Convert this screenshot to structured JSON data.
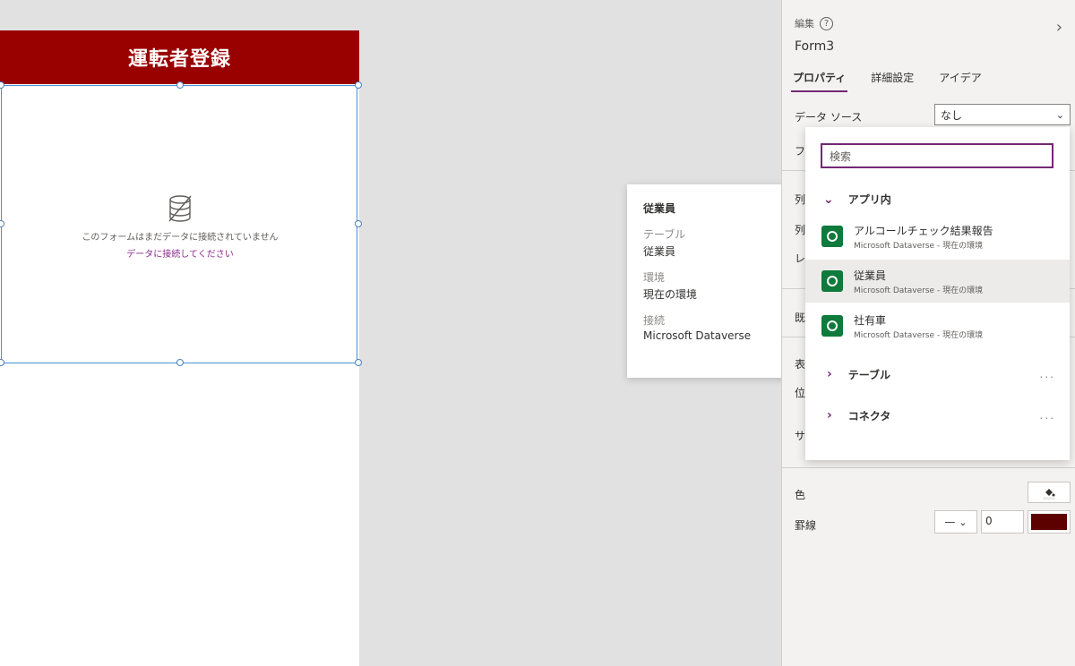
{
  "screen": {
    "title": "運転者登録",
    "form_message": "このフォームはまだデータに接続されていません",
    "form_link": "データに接続してください"
  },
  "info_card": {
    "title": "従業員",
    "table_label": "テーブル",
    "table_value": "従業員",
    "env_label": "環境",
    "env_value": "現在の環境",
    "conn_label": "接続",
    "conn_value": "Microsoft Dataverse"
  },
  "panel": {
    "edit_label": "編集",
    "help_icon": "?",
    "form_name": "Form3",
    "tabs": [
      "プロパティ",
      "詳細設定",
      "アイデア"
    ],
    "datasource_label": "データ ソース",
    "datasource_value": "なし",
    "cut_labels": [
      "フ",
      "列",
      "列",
      "レ",
      "既",
      "表",
      "位",
      "サ"
    ],
    "color_label": "色",
    "border_label": "罫線",
    "border_width": "0",
    "border_color": "#5c0000"
  },
  "dropdown": {
    "search_placeholder": "検索",
    "group_label": "アプリ内",
    "items": [
      {
        "name": "アルコールチェック結果報告",
        "sub": "Microsoft Dataverse - 現在の環境"
      },
      {
        "name": "従業員",
        "sub": "Microsoft Dataverse - 現在の環境"
      },
      {
        "name": "社有車",
        "sub": "Microsoft Dataverse - 現在の環境"
      }
    ],
    "more": [
      {
        "label": "テーブル",
        "ellipsis": "..."
      },
      {
        "label": "コネクタ",
        "ellipsis": "..."
      }
    ]
  },
  "colors": {
    "header": "#990000",
    "accent": "#742774",
    "dataverse_icon": "#0e7a3b"
  }
}
